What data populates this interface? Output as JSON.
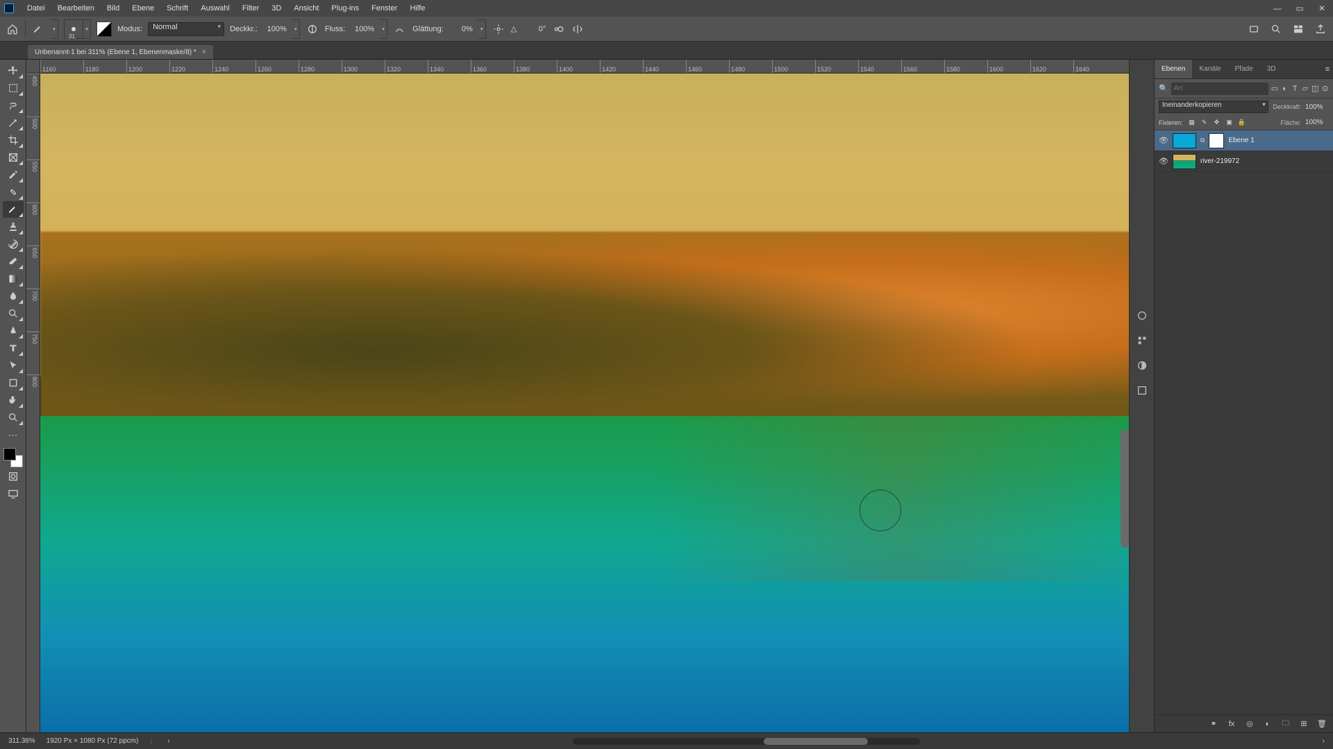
{
  "menu": [
    "Datei",
    "Bearbeiten",
    "Bild",
    "Ebene",
    "Schrift",
    "Auswahl",
    "Filter",
    "3D",
    "Ansicht",
    "Plug-ins",
    "Fenster",
    "Hilfe"
  ],
  "options": {
    "brush_size": "31",
    "mode_label": "Modus:",
    "mode_value": "Normal",
    "opacity_label": "Deckkr.:",
    "opacity_value": "100%",
    "flow_label": "Fluss:",
    "flow_value": "100%",
    "smooth_label": "Glättung:",
    "smooth_value": "0%",
    "angle_icon": "△",
    "angle_value": "0°"
  },
  "doc": {
    "title": "Unbenannt-1 bei 311% (Ebene 1, Ebenenmaske/8) *"
  },
  "ruler_h": [
    "1160",
    "1180",
    "1200",
    "1220",
    "1240",
    "1260",
    "1280",
    "1300",
    "1320",
    "1340",
    "1360",
    "1380",
    "1400",
    "1420",
    "1440",
    "1460",
    "1480",
    "1500",
    "1520",
    "1540",
    "1560",
    "1580",
    "1600",
    "1620",
    "1640"
  ],
  "ruler_v": [
    "450",
    "500",
    "550",
    "600",
    "650",
    "700",
    "750",
    "800"
  ],
  "panel_tabs": [
    "Ebenen",
    "Kanäle",
    "Pfade",
    "3D"
  ],
  "search_placeholder": "Art",
  "blend": {
    "mode": "Ineinanderkopieren",
    "opacity_label": "Deckkraft:",
    "opacity_value": "100%",
    "lock_label": "Fixieren:",
    "fill_label": "Fläche:",
    "fill_value": "100%"
  },
  "layers": [
    {
      "name": "Ebene 1",
      "selected": true,
      "has_mask": true,
      "visible": true
    },
    {
      "name": "river-219972",
      "selected": false,
      "has_mask": false,
      "visible": true
    }
  ],
  "status": {
    "zoom": "311.36%",
    "info": "1920 Px × 1080 Px (72 ppcm)"
  }
}
